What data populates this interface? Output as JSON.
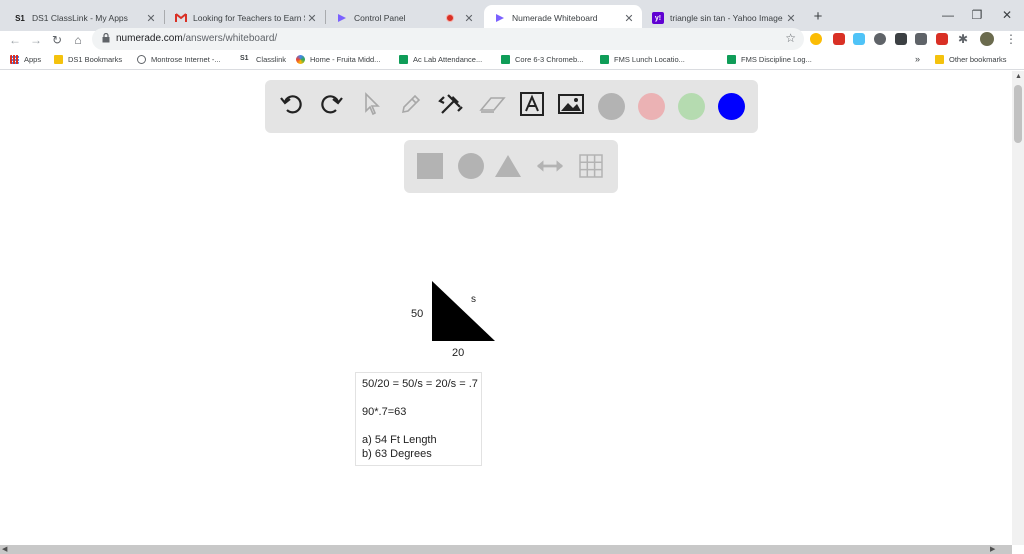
{
  "browser": {
    "tabs": [
      {
        "title": "DS1 ClassLink - My Apps",
        "icon": "classlink-icon",
        "active": false
      },
      {
        "title": "Looking for Teachers to Earn $$$",
        "icon": "gmail-icon",
        "active": false
      },
      {
        "title": "Control Panel",
        "icon": "numerade-icon",
        "active": false
      },
      {
        "title": "Numerade Whiteboard",
        "icon": "numerade-icon",
        "active": true
      },
      {
        "title": "triangle sin tan - Yahoo Image Se",
        "icon": "yahoo-icon",
        "active": false
      }
    ],
    "new_tab": "+",
    "window_controls": {
      "minimize": "—",
      "maximize": "❐",
      "close": "✕"
    },
    "nav": {
      "back": "←",
      "forward": "→",
      "reload": "↻",
      "home": "⌂",
      "star": "☆"
    },
    "url_host": "numerade.com",
    "url_path": "/answers/whiteboard/",
    "bookmarks": [
      {
        "label": "Apps",
        "icon": "apps-grid-icon"
      },
      {
        "label": "DS1 Bookmarks",
        "icon": "folder-icon"
      },
      {
        "label": "Montrose Internet -...",
        "icon": "globe-icon"
      },
      {
        "label": "Classlink",
        "icon": "classlink-icon"
      },
      {
        "label": "Home - Fruita Midd...",
        "icon": "site-icon"
      },
      {
        "label": "Ac Lab Attendance...",
        "icon": "sheets-icon"
      },
      {
        "label": "Core 6-3 Chromeb...",
        "icon": "sheets-icon"
      },
      {
        "label": "FMS Lunch Locatio...",
        "icon": "sheets-icon"
      },
      {
        "label": "FMS Discipline Log...",
        "icon": "sheets-icon"
      }
    ],
    "bookmarks_overflow": "»",
    "other_bookmarks": "Other bookmarks"
  },
  "whiteboard": {
    "tools": [
      "undo-icon",
      "redo-icon",
      "pointer-icon",
      "pen-icon",
      "tools-icon",
      "eraser-icon",
      "text-tool-icon",
      "image-tool-icon"
    ],
    "colors": [
      "#b3b3b3",
      "#ebb2b4",
      "#b5dbb0",
      "#0000ff"
    ],
    "selected_color": "#0000ff",
    "shapes": [
      "square-icon",
      "circle-icon",
      "triangle-icon",
      "arrow-icon",
      "grid-icon"
    ],
    "triangle_labels": {
      "left": "50",
      "hyp": "s",
      "bottom": "20"
    },
    "notes": [
      "50/20 = 50/s = 20/s = .7",
      "90*.7=63",
      "a) 54 Ft Length",
      "b) 63 Degrees"
    ]
  }
}
